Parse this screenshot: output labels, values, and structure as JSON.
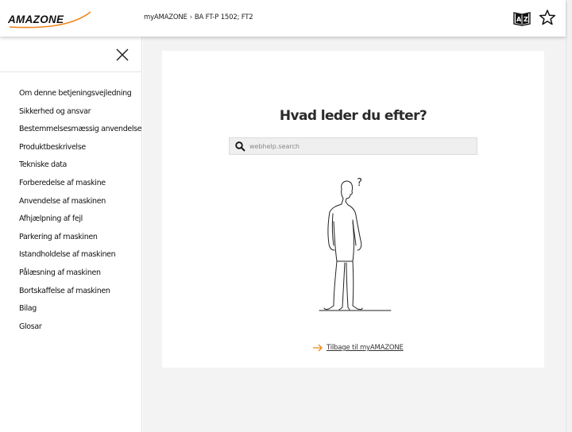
{
  "header": {
    "logo_text": "AMAZONE",
    "breadcrumb": [
      "myAMAZONE",
      "BA FT-P 1502; FT2"
    ],
    "breadcrumb_separator": "›",
    "icons": [
      "glossary-az-icon",
      "bookmark-star-icon"
    ]
  },
  "sidebar": {
    "close_icon": "close-icon",
    "items": [
      {
        "label": "Om denne betjeningsvejledning"
      },
      {
        "label": "Sikkerhed og ansvar"
      },
      {
        "label": "Bestemmelsesmæssig anvendelse"
      },
      {
        "label": "Produktbeskrivelse"
      },
      {
        "label": "Tekniske data"
      },
      {
        "label": "Forberedelse af maskine"
      },
      {
        "label": "Anvendelse af maskinen"
      },
      {
        "label": "Afhjælpning af fejl"
      },
      {
        "label": "Parkering af maskinen"
      },
      {
        "label": "Istandholdelse af maskinen"
      },
      {
        "label": "Pålæsning af maskinen"
      },
      {
        "label": "Bortskaffelse af maskinen"
      },
      {
        "label": "Bilag"
      },
      {
        "label": "Glosar"
      }
    ]
  },
  "main": {
    "title": "Hvad leder du efter?",
    "search": {
      "placeholder": "webhelp.search",
      "value": ""
    },
    "illustration": "thinking-man-illustration",
    "question_mark": "?",
    "back_link": "Tilbage til myAMAZONE"
  },
  "colors": {
    "brand_orange": "#f0841c",
    "background": "#f3f3f3",
    "text": "#222222"
  }
}
